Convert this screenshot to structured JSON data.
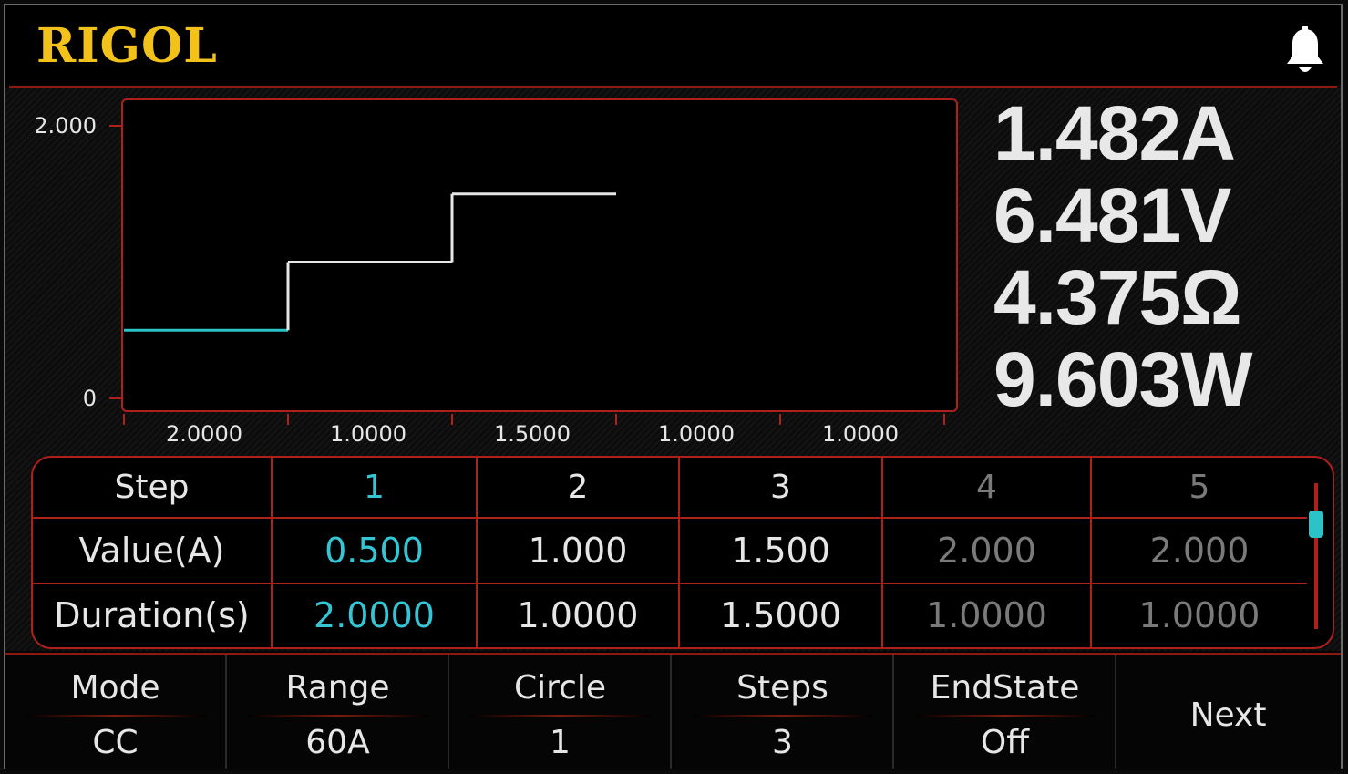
{
  "header": {
    "logo_text": "RIGOL",
    "notification_icon": "bell-icon"
  },
  "measurements": {
    "current": "1.482A",
    "voltage": "6.481V",
    "resistance": "4.375Ω",
    "power": "9.603W"
  },
  "chart_data": {
    "type": "line",
    "title": "",
    "xlabel": "",
    "ylabel": "",
    "y_tick_labels": [
      "2.000",
      "0"
    ],
    "ylim": [
      0,
      2
    ],
    "x_tick_labels": [
      "2.0000",
      "1.0000",
      "1.5000",
      "1.0000",
      "1.0000"
    ],
    "steps": [
      {
        "duration": 2.0,
        "value": 0.5,
        "active": true
      },
      {
        "duration": 1.0,
        "value": 1.0,
        "active": false
      },
      {
        "duration": 1.5,
        "value": 1.5,
        "active": false
      }
    ],
    "colors": {
      "active": "#2bc2c8",
      "trace": "#e6e6e6",
      "axis": "#b0201a"
    }
  },
  "table": {
    "row_labels": {
      "step": "Step",
      "value": "Value(A)",
      "duration": "Duration(s)"
    },
    "columns": [
      {
        "step": "1",
        "value": "0.500",
        "duration": "2.0000",
        "state": "active"
      },
      {
        "step": "2",
        "value": "1.000",
        "duration": "1.0000",
        "state": "normal"
      },
      {
        "step": "3",
        "value": "1.500",
        "duration": "1.5000",
        "state": "normal"
      },
      {
        "step": "4",
        "value": "2.000",
        "duration": "1.0000",
        "state": "dim"
      },
      {
        "step": "5",
        "value": "2.000",
        "duration": "1.0000",
        "state": "dim"
      }
    ]
  },
  "menu": {
    "mode": {
      "label": "Mode",
      "value": "CC"
    },
    "range": {
      "label": "Range",
      "value": "60A"
    },
    "circle": {
      "label": "Circle",
      "value": "1"
    },
    "steps": {
      "label": "Steps",
      "value": "3"
    },
    "endstate": {
      "label": "EndState",
      "value": "Off"
    },
    "next": {
      "label": "Next"
    }
  }
}
